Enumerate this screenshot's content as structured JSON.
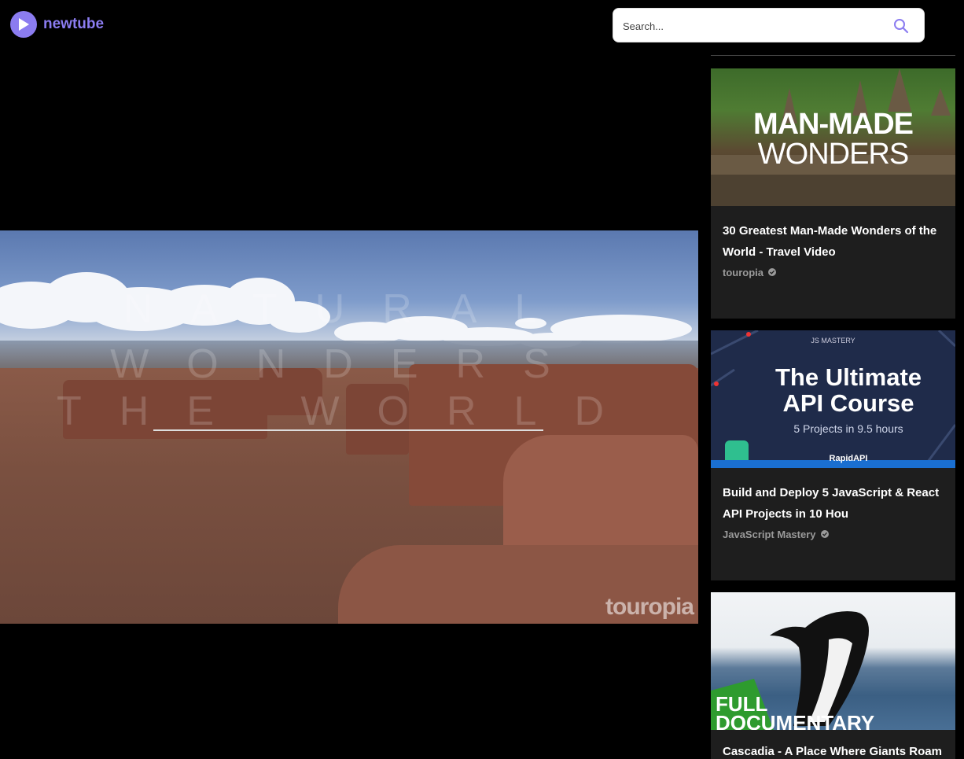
{
  "header": {
    "brand": "newtube",
    "search_placeholder": "Search..."
  },
  "player": {
    "overlay_lines": [
      "NATURAL",
      "WONDERS",
      "THE WORLD"
    ],
    "watermark": "touropia"
  },
  "related": [
    {
      "thumb_text_1": "MAN-MADE",
      "thumb_text_2": "WONDERS",
      "title": "30 Greatest Man-Made Wonders of the World - Travel Video",
      "channel": "touropia"
    },
    {
      "thumb_badge": "JS MASTERY",
      "thumb_text_1": "The Ultimate",
      "thumb_text_2": "API Course",
      "thumb_sub": "5 Projects in 9.5 hours",
      "thumb_brand": "RapidAPI",
      "title": "Build and Deploy 5 JavaScript & React API Projects in 10 Hou",
      "channel": "JavaScript Mastery"
    },
    {
      "thumb_text_1": "FULL",
      "thumb_text_2": "DOCUMENTARY",
      "title": "Cascadia - A Place Where Giants Roam",
      "channel": ""
    }
  ],
  "colors": {
    "accent": "#8b7cf0",
    "card_bg": "#1e1e1e",
    "channel_text": "#9a9a9a"
  }
}
